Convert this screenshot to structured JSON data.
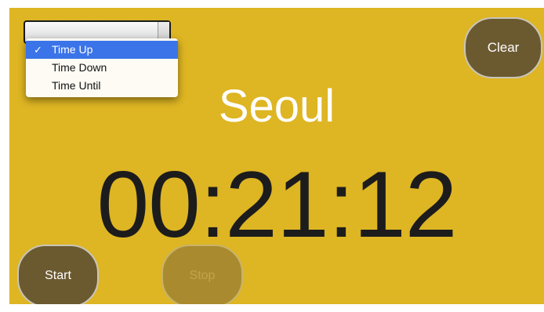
{
  "mode_select": {
    "options": [
      {
        "label": "Time Up",
        "selected": true,
        "check": "✓"
      },
      {
        "label": "Time Down",
        "selected": false
      },
      {
        "label": "Time Until",
        "selected": false
      }
    ]
  },
  "display": {
    "city": "Seoul",
    "time": "00:21:12"
  },
  "buttons": {
    "clear": "Clear",
    "start": "Start",
    "stop": "Stop",
    "stop_enabled": false
  },
  "colors": {
    "background": "#deb523",
    "button": "#6b5930",
    "button_disabled": "#a98a2e",
    "highlight": "#3b74e8"
  }
}
